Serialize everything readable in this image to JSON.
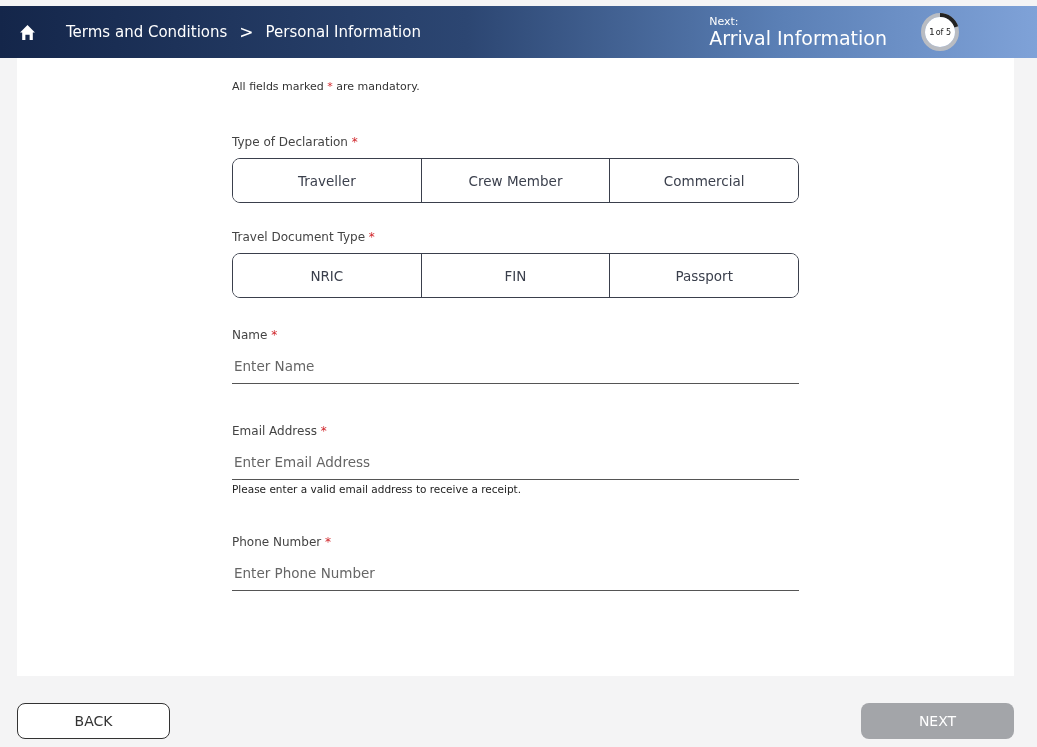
{
  "header": {
    "breadcrumb": [
      {
        "label": "Terms and Conditions"
      },
      {
        "label": "Personal Information"
      }
    ],
    "separator": ">",
    "next_label": "Next:",
    "next_title": "Arrival Information",
    "progress": {
      "current": "1",
      "total": "of 5",
      "level": 0.2
    }
  },
  "notice": {
    "before": "All fields marked",
    "mark": "*",
    "after": "are mandatory."
  },
  "groups": [
    {
      "label": "Type of Declaration",
      "mark": "*",
      "options": [
        {
          "label": "Traveller",
          "selected": false
        },
        {
          "label": "Crew Member",
          "selected": false
        },
        {
          "label": "Commercial",
          "selected": false
        }
      ]
    },
    {
      "label": "Travel Document Type",
      "mark": "*",
      "options": [
        {
          "label": "NRIC",
          "selected": false
        },
        {
          "label": "FIN",
          "selected": false
        },
        {
          "label": "Passport",
          "selected": false
        }
      ]
    }
  ],
  "fields": [
    {
      "label": "Name",
      "mark": "*",
      "placeholder": "Enter Name"
    },
    {
      "label": "Email Address",
      "mark": "*",
      "placeholder": "Enter Email Address",
      "hint": "Please enter a valid email address to receive a receipt."
    },
    {
      "label": "Phone Number",
      "mark": "*",
      "placeholder": "Enter Phone Number"
    }
  ],
  "buttons": [
    {
      "label": "BACK",
      "disabled": false
    },
    {
      "label": "NEXT",
      "disabled": true
    }
  ]
}
